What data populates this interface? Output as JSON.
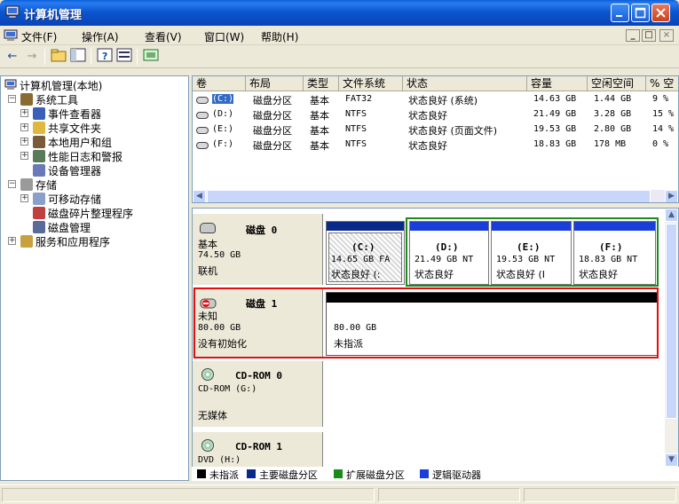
{
  "window": {
    "title": "计算机管理",
    "app_icon": "computer-management-icon"
  },
  "menu": {
    "items": [
      "文件(F)",
      "操作(A)",
      "查看(V)",
      "窗口(W)",
      "帮助(H)"
    ]
  },
  "tree": {
    "root": "计算机管理(本地)",
    "items": [
      {
        "label": "系统工具",
        "icon": "tools-icon"
      },
      {
        "label": "事件查看器",
        "icon": "event-viewer-icon"
      },
      {
        "label": "共享文件夹",
        "icon": "shared-folder-icon"
      },
      {
        "label": "本地用户和组",
        "icon": "users-icon"
      },
      {
        "label": "性能日志和警报",
        "icon": "performance-icon"
      },
      {
        "label": "设备管理器",
        "icon": "device-manager-icon"
      },
      {
        "label": "存储",
        "icon": "storage-icon"
      },
      {
        "label": "可移动存储",
        "icon": "removable-storage-icon"
      },
      {
        "label": "磁盘碎片整理程序",
        "icon": "defrag-icon"
      },
      {
        "label": "磁盘管理",
        "icon": "disk-management-icon"
      },
      {
        "label": "服务和应用程序",
        "icon": "services-icon"
      }
    ]
  },
  "volumes": {
    "headers": [
      "卷",
      "布局",
      "类型",
      "文件系统",
      "状态",
      "容量",
      "空闲空间",
      "% 空"
    ],
    "rows": [
      {
        "vol": "(C:)",
        "layout": "磁盘分区",
        "type": "基本",
        "fs": "FAT32",
        "status": "状态良好 (系统)",
        "capacity": "14.63 GB",
        "free": "1.44 GB",
        "pct": "9 %"
      },
      {
        "vol": "(D:)",
        "layout": "磁盘分区",
        "type": "基本",
        "fs": "NTFS",
        "status": "状态良好",
        "capacity": "21.49 GB",
        "free": "3.28 GB",
        "pct": "15 %"
      },
      {
        "vol": "(E:)",
        "layout": "磁盘分区",
        "type": "基本",
        "fs": "NTFS",
        "status": "状态良好 (页面文件)",
        "capacity": "19.53 GB",
        "free": "2.80 GB",
        "pct": "14 %"
      },
      {
        "vol": "(F:)",
        "layout": "磁盘分区",
        "type": "基本",
        "fs": "NTFS",
        "status": "状态良好",
        "capacity": "18.83 GB",
        "free": "178 MB",
        "pct": "0 %"
      }
    ]
  },
  "disks": {
    "disk0": {
      "name": "磁盘 0",
      "type": "基本",
      "size": "74.50 GB",
      "state": "联机",
      "partitions": [
        {
          "label": "(C:)",
          "size": "14.65 GB FA",
          "status": "状态良好 (:"
        },
        {
          "label": "(D:)",
          "size": "21.49 GB NT",
          "status": "状态良好"
        },
        {
          "label": "(E:)",
          "size": "19.53 GB NT",
          "status": "状态良好 (I"
        },
        {
          "label": "(F:)",
          "size": "18.83 GB NT",
          "status": "状态良好"
        }
      ]
    },
    "disk1": {
      "name": "磁盘 1",
      "type": "未知",
      "size": "80.00 GB",
      "state": "没有初始化",
      "partition": {
        "size": "80.00 GB",
        "status": "未指派"
      }
    },
    "cdrom0": {
      "name": "CD-ROM 0",
      "type": "CD-ROM (G:)",
      "media": "无媒体"
    },
    "cdrom1": {
      "name": "CD-ROM 1",
      "type": "DVD (H:)"
    }
  },
  "legend": {
    "items": [
      {
        "label": "未指派",
        "color": "#000000"
      },
      {
        "label": "主要磁盘分区",
        "color": "#0a2a8a"
      },
      {
        "label": "扩展磁盘分区",
        "color": "#1a8a1a"
      },
      {
        "label": "逻辑驱动器",
        "color": "#1a3ed8"
      }
    ]
  },
  "colors": {
    "highlight_red": "#e01010",
    "extended_green": "#1a8a1a",
    "selection": "#316ac5"
  }
}
